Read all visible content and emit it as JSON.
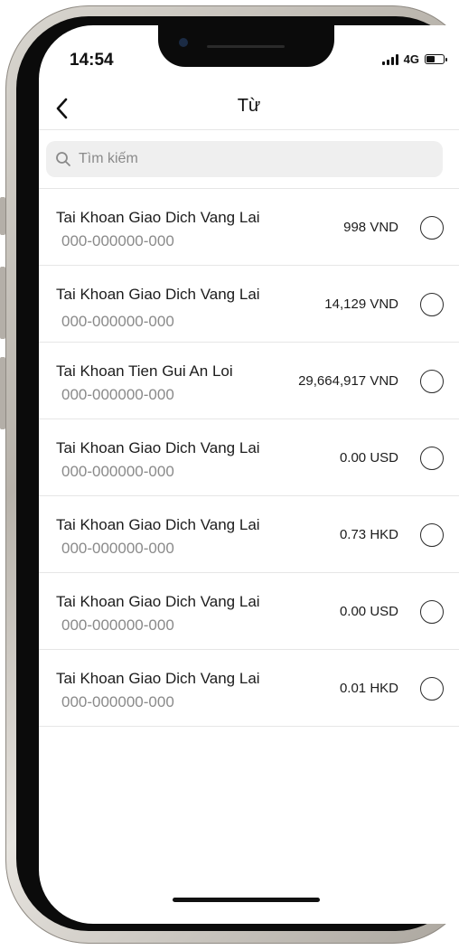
{
  "status_bar": {
    "time": "14:54",
    "network": "4G"
  },
  "header": {
    "title": "Từ",
    "back_icon": "chevron-left-icon"
  },
  "search": {
    "placeholder": "Tìm kiếm",
    "icon": "search-icon"
  },
  "accounts": [
    {
      "name": "Tai Khoan Giao Dich Vang Lai",
      "number": "000-000000-000",
      "amount": "998 VND"
    },
    {
      "name": "Tai Khoan Giao Dich Vang Lai",
      "number": "000-000000-000",
      "amount": "14,129 VND"
    },
    {
      "name": "Tai Khoan Tien Gui An Loi",
      "number": "000-000000-000",
      "amount": "29,664,917 VND"
    },
    {
      "name": "Tai Khoan Giao Dich Vang Lai",
      "number": "000-000000-000",
      "amount": "0.00 USD"
    },
    {
      "name": "Tai Khoan Giao Dich Vang Lai",
      "number": "000-000000-000",
      "amount": "0.73 HKD"
    },
    {
      "name": "Tai Khoan Giao Dich Vang Lai",
      "number": "000-000000-000",
      "amount": "0.00 USD"
    },
    {
      "name": "Tai Khoan Giao Dich Vang Lai",
      "number": "000-000000-000",
      "amount": "0.01 HKD"
    }
  ]
}
